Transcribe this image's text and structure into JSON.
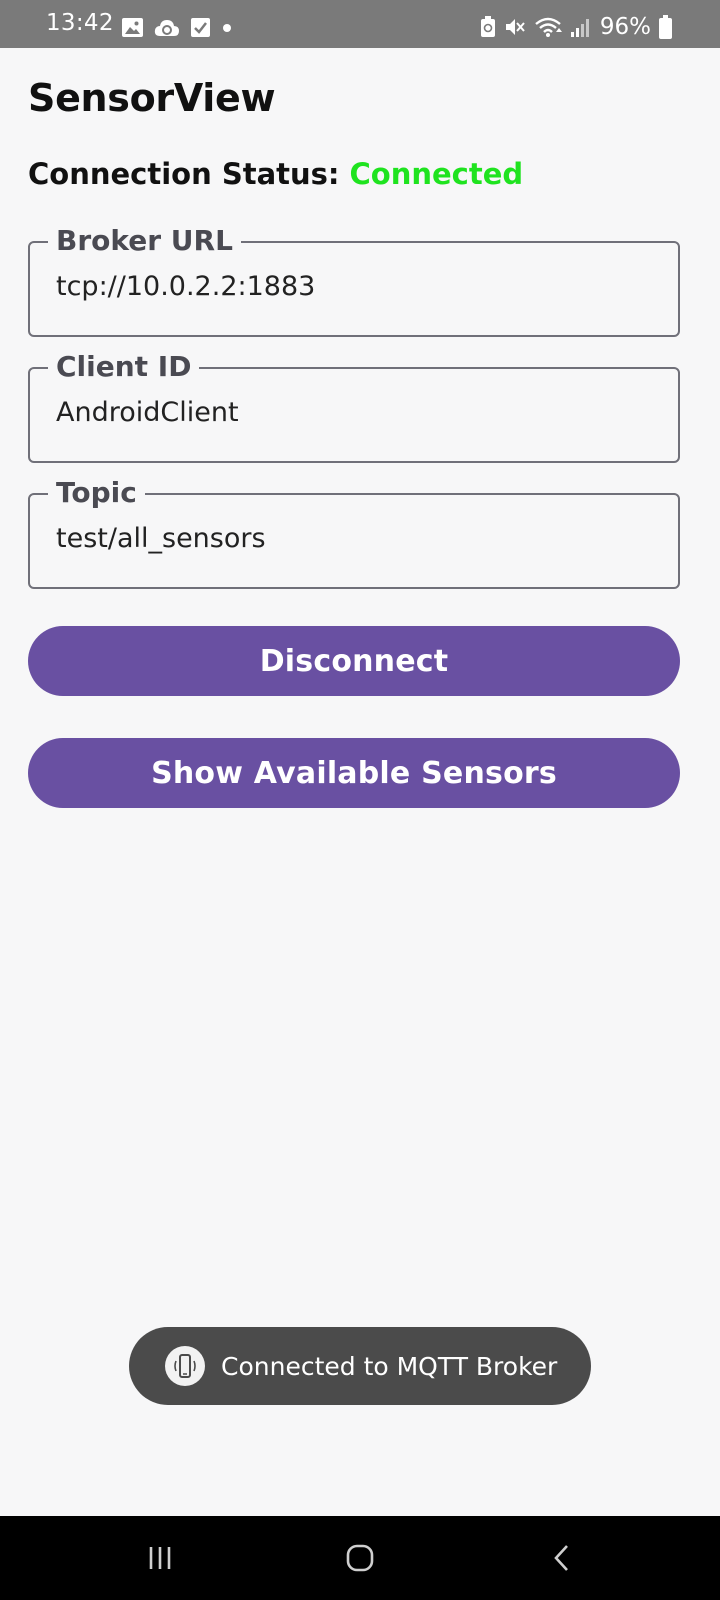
{
  "status_bar": {
    "time": "13:42",
    "battery": "96%",
    "left_icons": [
      "image-icon",
      "cloud-sync-icon",
      "checkbox-icon",
      "dot-icon"
    ],
    "right_icons": [
      "battery-saver-icon",
      "mute-icon",
      "wifi-icon",
      "signal-icon",
      "battery-icon"
    ]
  },
  "app": {
    "title": "SensorView"
  },
  "connection": {
    "label": "Connection Status:",
    "value": "Connected",
    "value_color": "#1fe31f"
  },
  "fields": {
    "broker_url": {
      "label": "Broker URL",
      "value": "tcp://10.0.2.2:1883"
    },
    "client_id": {
      "label": "Client ID",
      "value": "AndroidClient"
    },
    "topic": {
      "label": "Topic",
      "value": "test/all_sensors"
    }
  },
  "buttons": {
    "disconnect": "Disconnect",
    "show_sensors": "Show Available Sensors",
    "color": "#6950a2"
  },
  "toast": {
    "message": "Connected to MQTT Broker",
    "icon": "phone-vibrate-icon"
  },
  "nav_bar": {
    "icons": [
      "recents-icon",
      "home-icon",
      "back-icon"
    ]
  }
}
